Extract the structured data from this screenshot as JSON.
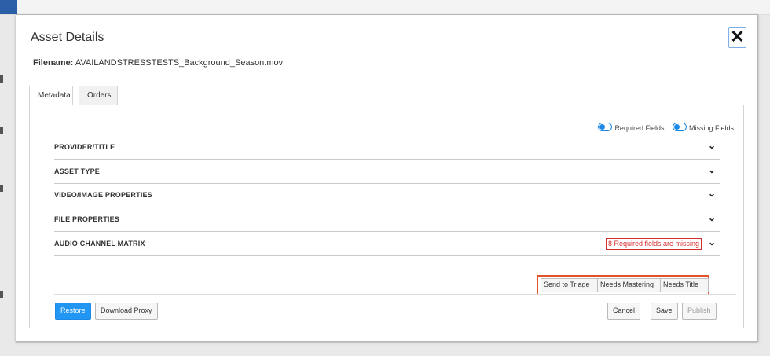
{
  "modal": {
    "title": "Asset Details",
    "close_glyph": "✕",
    "filename_label": "Filename:",
    "filename_value": "AVAILANDSTRESSTESTS_Background_Season.mov"
  },
  "tabs": [
    {
      "label": "Metadata",
      "active": true
    },
    {
      "label": "Orders",
      "active": false
    }
  ],
  "toggles": [
    {
      "label": "Required Fields"
    },
    {
      "label": "Missing Fields"
    }
  ],
  "sections": [
    {
      "label": "PROVIDER/TITLE"
    },
    {
      "label": "ASSET TYPE"
    },
    {
      "label": "VIDEO/IMAGE PROPERTIES"
    },
    {
      "label": "FILE PROPERTIES"
    },
    {
      "label": "AUDIO CHANNEL MATRIX",
      "warning": "8 Required fields are missing"
    }
  ],
  "chevron_glyph": "⌄",
  "status_buttons": [
    "Send to Triage",
    "Needs Mastering",
    "Needs Title"
  ],
  "footer": {
    "restore": "Restore",
    "download_proxy": "Download Proxy",
    "cancel": "Cancel",
    "save": "Save",
    "publish": "Publish"
  },
  "colors": {
    "accent": "#2196f3",
    "warning": "#d32f2f",
    "highlight": "#e2532a"
  }
}
